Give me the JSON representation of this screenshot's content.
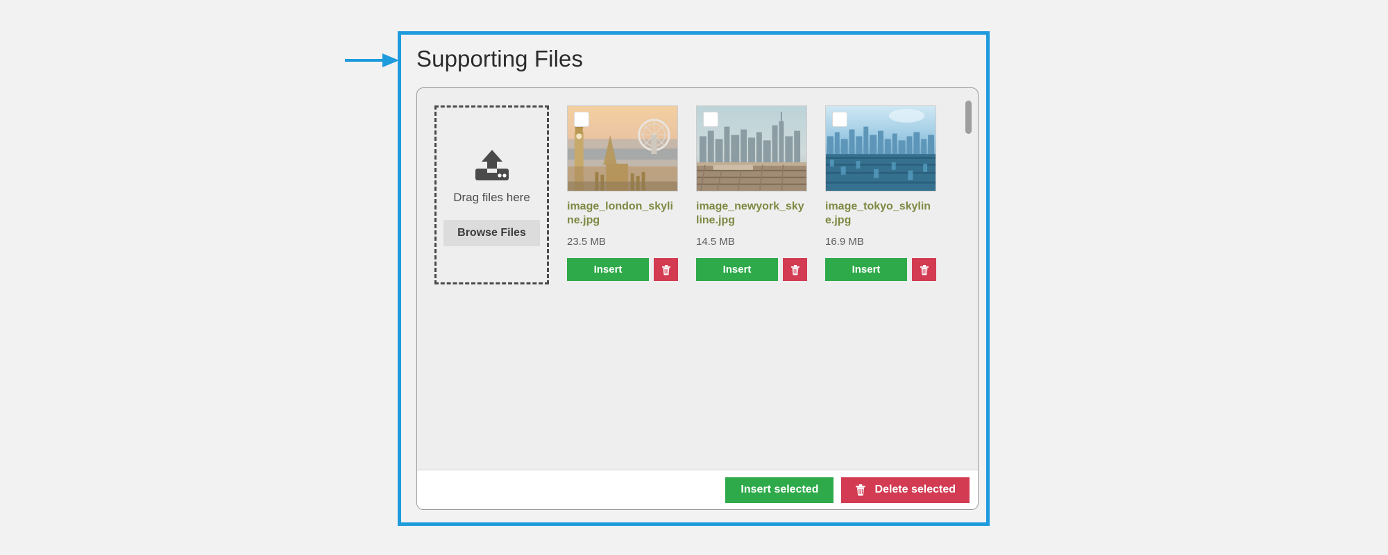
{
  "panel": {
    "title": "Supporting Files",
    "accent_color": "#1e9bdc"
  },
  "annotation": {
    "arrow_icon": "arrow-right-icon",
    "color": "#1e9bdc"
  },
  "dropzone": {
    "icon": "upload-icon",
    "label": "Drag files here",
    "browse_label": "Browse Files"
  },
  "files": [
    {
      "name": "image_london_skyline.jpg",
      "size": "23.5 MB",
      "checkbox_checked": false,
      "insert_label": "Insert",
      "delete_icon": "trash-icon",
      "thumbnail": "london-skyline-thumbnail"
    },
    {
      "name": "image_newyork_skyline.jpg",
      "size": "14.5 MB",
      "checkbox_checked": false,
      "insert_label": "Insert",
      "delete_icon": "trash-icon",
      "thumbnail": "newyork-skyline-thumbnail"
    },
    {
      "name": "image_tokyo_skyline.jpg",
      "size": "16.9 MB",
      "checkbox_checked": false,
      "insert_label": "Insert",
      "delete_icon": "trash-icon",
      "thumbnail": "tokyo-skyline-thumbnail"
    }
  ],
  "bulk_actions": {
    "insert_selected_label": "Insert selected",
    "delete_selected_label": "Delete selected",
    "delete_icon": "trash-icon",
    "insert_color": "#2eaa4a",
    "delete_color": "#d23b52"
  },
  "scrollbar": {
    "name": "vertical-scrollbar"
  }
}
